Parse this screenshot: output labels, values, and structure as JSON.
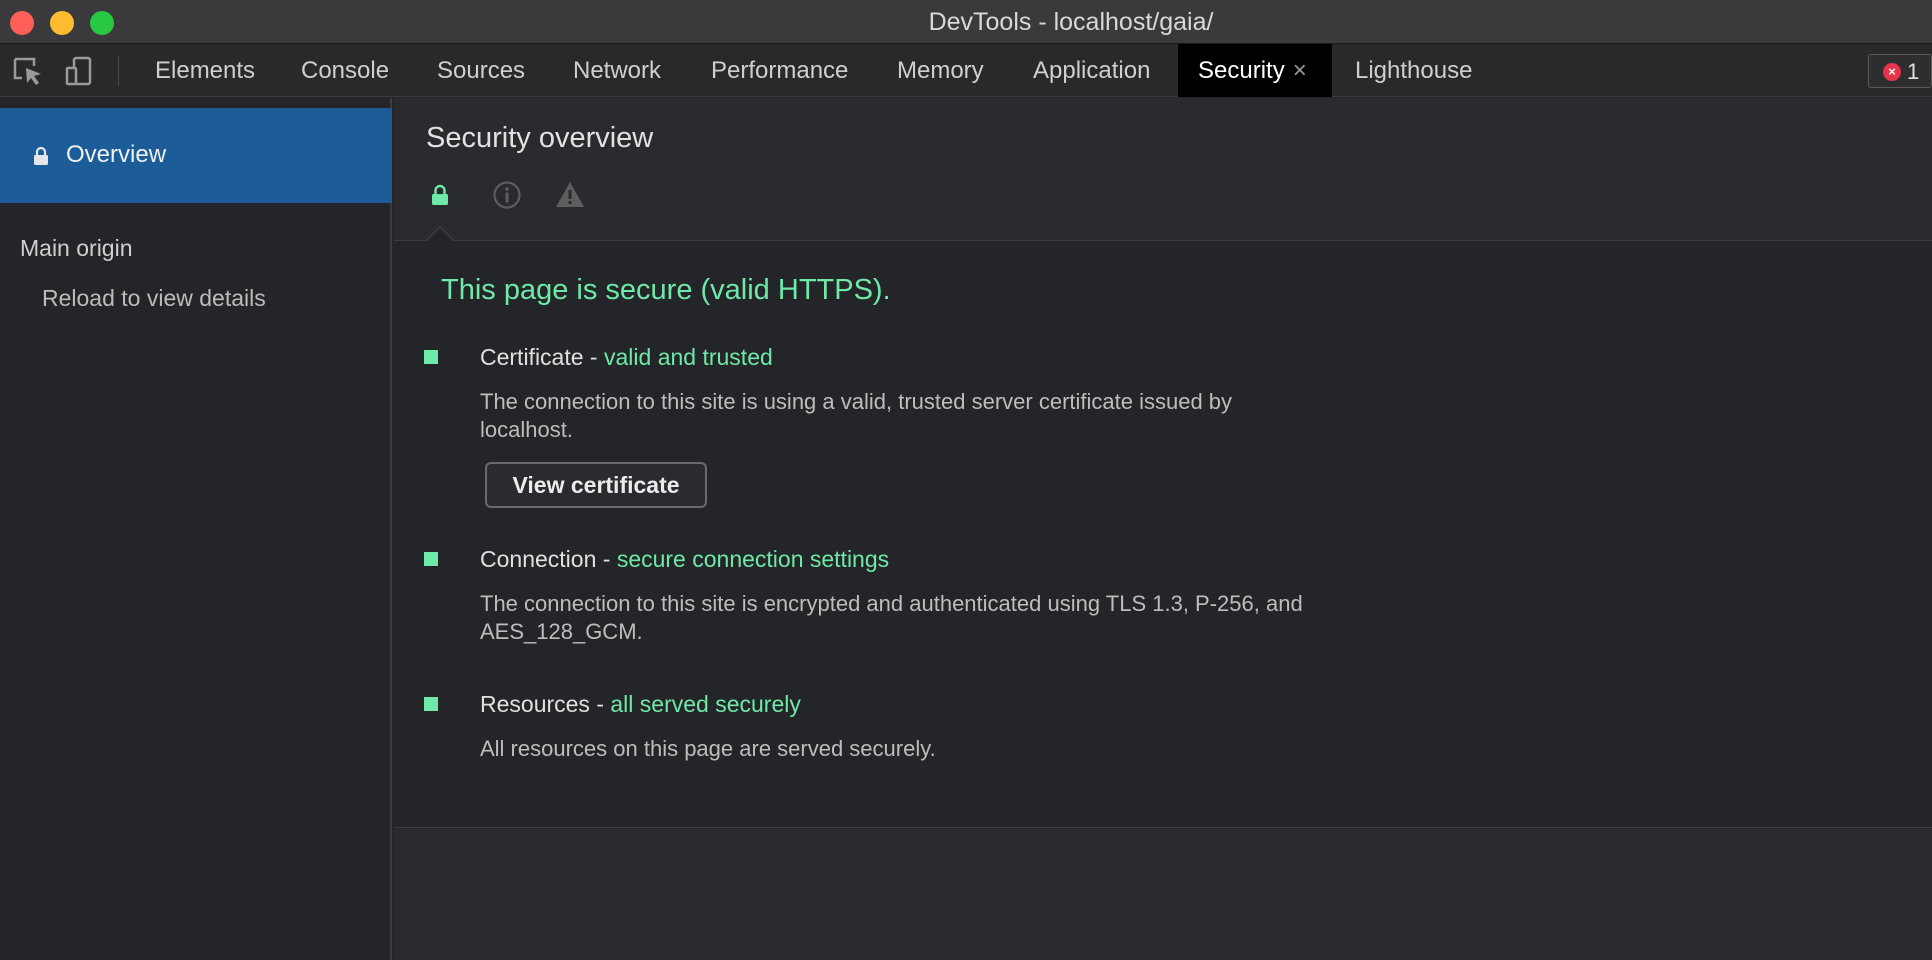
{
  "window": {
    "title": "DevTools - localhost/gaia/"
  },
  "toolbar": {
    "inspect_icon": "element-picker-icon",
    "device_icon": "device-toolbar-icon",
    "tabs": [
      {
        "label": "Elements"
      },
      {
        "label": "Console"
      },
      {
        "label": "Sources"
      },
      {
        "label": "Network"
      },
      {
        "label": "Performance"
      },
      {
        "label": "Memory"
      },
      {
        "label": "Application"
      },
      {
        "label": "Security",
        "active": true,
        "close": "×"
      },
      {
        "label": "Lighthouse"
      }
    ],
    "error_count": "1"
  },
  "sidebar": {
    "overview_label": "Overview",
    "main_origin_heading": "Main origin",
    "reload_text": "Reload to view details"
  },
  "main": {
    "title": "Security overview",
    "summary": "This page is secure (valid HTTPS).",
    "items": [
      {
        "title": "Certificate",
        "separator": " - ",
        "status": "valid and trusted",
        "description": "The connection to this site is using a valid, trusted server certificate issued by localhost.",
        "button": "View certificate"
      },
      {
        "title": "Connection",
        "separator": " - ",
        "status": "secure connection settings",
        "description": "The connection to this site is encrypted and authenticated using TLS 1.3, P-256, and AES_128_GCM."
      },
      {
        "title": "Resources",
        "separator": " - ",
        "status": "all served securely",
        "description": "All resources on this page are served securely."
      }
    ]
  },
  "colors": {
    "accent_green": "#6ee9a8",
    "sidebar_selected": "#1c5d99",
    "error_red": "#e8344a"
  }
}
